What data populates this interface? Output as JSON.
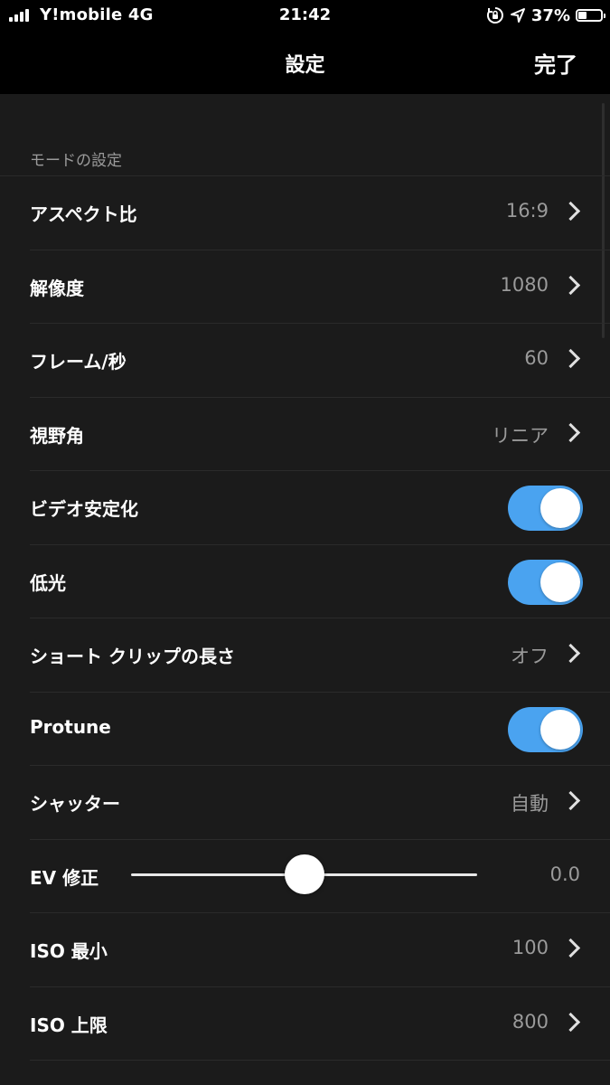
{
  "status_bar": {
    "carrier": "Y!mobile  4G",
    "time": "21:42",
    "battery_percent": "37%",
    "battery_level": 0.37,
    "icons": [
      "signal-icon",
      "orientation-lock-icon",
      "location-icon",
      "battery-icon"
    ]
  },
  "nav": {
    "title": "設定",
    "done_label": "完了"
  },
  "section": {
    "header": "モードの設定"
  },
  "rows": [
    {
      "label": "アスペクト比",
      "value": "16:9",
      "type": "disclosure"
    },
    {
      "label": "解像度",
      "value": "1080",
      "type": "disclosure"
    },
    {
      "label": "フレーム/秒",
      "value": "60",
      "type": "disclosure"
    },
    {
      "label": "視野角",
      "value": "リニア",
      "type": "disclosure"
    },
    {
      "label": "ビデオ安定化",
      "type": "toggle",
      "on": true
    },
    {
      "label": "低光",
      "type": "toggle",
      "on": true
    },
    {
      "label": "ショート クリップの長さ",
      "value": "オフ",
      "type": "disclosure"
    },
    {
      "label": "Protune",
      "type": "toggle",
      "on": true
    },
    {
      "label": "シャッター",
      "value": "自動",
      "type": "disclosure"
    },
    {
      "label": "EV 修正",
      "value": "0.0",
      "type": "slider",
      "slider_fraction": 0.5
    },
    {
      "label": "ISO 最小",
      "value": "100",
      "type": "disclosure"
    },
    {
      "label": "ISO 上限",
      "value": "800",
      "type": "disclosure"
    }
  ],
  "colors": {
    "accent": "#4aa3f0",
    "background": "#1b1b1b",
    "secondary_text": "#9a9a9a"
  }
}
